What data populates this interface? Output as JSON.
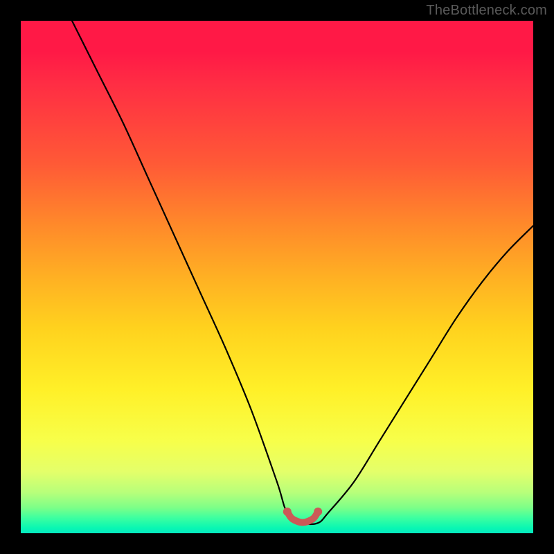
{
  "watermark": "TheBottleneck.com",
  "chart_data": {
    "type": "line",
    "title": "",
    "xlabel": "",
    "ylabel": "",
    "xlim": [
      0,
      100
    ],
    "ylim": [
      0,
      100
    ],
    "grid": false,
    "series": [
      {
        "name": "bottleneck-curve",
        "color": "#000000",
        "x": [
          10,
          15,
          20,
          25,
          30,
          35,
          40,
          45,
          50,
          52,
          55,
          58,
          60,
          65,
          70,
          75,
          80,
          85,
          90,
          95,
          100
        ],
        "y": [
          100,
          90,
          80,
          69,
          58,
          47,
          36,
          24,
          10,
          4,
          2,
          2,
          4,
          10,
          18,
          26,
          34,
          42,
          49,
          55,
          60
        ]
      },
      {
        "name": "optimal-range-marker",
        "color": "#cc5a57",
        "x": [
          52,
          53,
          55,
          57,
          58
        ],
        "y": [
          4.2,
          2.8,
          2.1,
          2.8,
          4.2
        ]
      }
    ],
    "gradient_stops": [
      {
        "pos": 0,
        "color": "#ff1946"
      },
      {
        "pos": 50,
        "color": "#ffb023"
      },
      {
        "pos": 72,
        "color": "#fff028"
      },
      {
        "pos": 95,
        "color": "#7dff88"
      },
      {
        "pos": 100,
        "color": "#06e8c0"
      }
    ]
  }
}
